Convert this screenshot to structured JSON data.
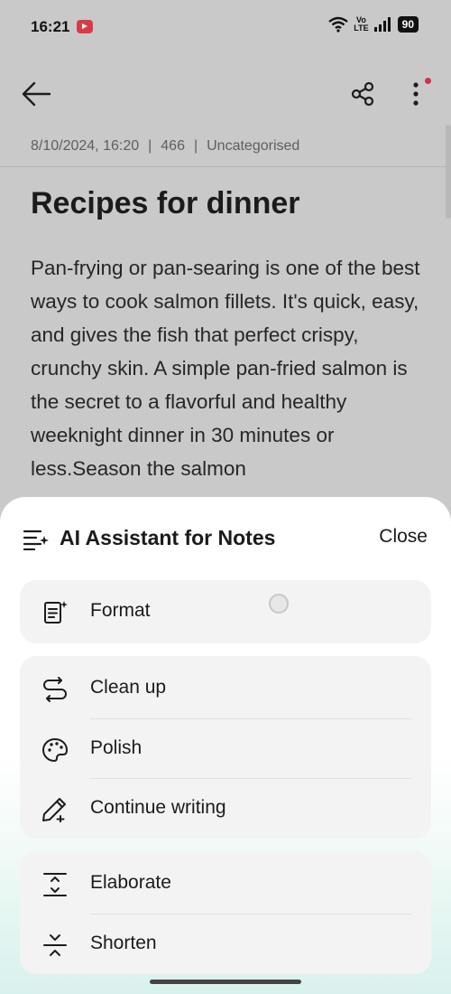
{
  "status_bar": {
    "time": "16:21",
    "volte_top": "Vo",
    "volte_bottom": "LTE",
    "battery": "90"
  },
  "note": {
    "date": "8/10/2024, 16:20",
    "word_count": "466",
    "category": "Uncategorised",
    "meta_separator": "|",
    "title": "Recipes for dinner",
    "body": "Pan-frying or pan-searing is one of the best ways to cook salmon fillets. It's quick, easy, and gives the fish that perfect crispy, crunchy skin. A simple pan-fried salmon is the secret to a flavorful and healthy weeknight dinner in 30 minutes or less.Season the salmon"
  },
  "sheet": {
    "title": "AI Assistant for Notes",
    "close_label": "Close",
    "groups": [
      {
        "items": [
          {
            "label": "Format",
            "icon": "format-icon"
          }
        ]
      },
      {
        "items": [
          {
            "label": "Clean up",
            "icon": "clean-up-icon"
          },
          {
            "label": "Polish",
            "icon": "palette-icon"
          },
          {
            "label": "Continue writing",
            "icon": "pen-plus-icon"
          }
        ]
      },
      {
        "items": [
          {
            "label": "Elaborate",
            "icon": "expand-icon"
          },
          {
            "label": "Shorten",
            "icon": "collapse-icon"
          }
        ]
      }
    ]
  },
  "colors": {
    "accent_dot": "#d3304a",
    "recording_badge": "#d93b46",
    "dim_overlay": "#c9c9c9"
  }
}
